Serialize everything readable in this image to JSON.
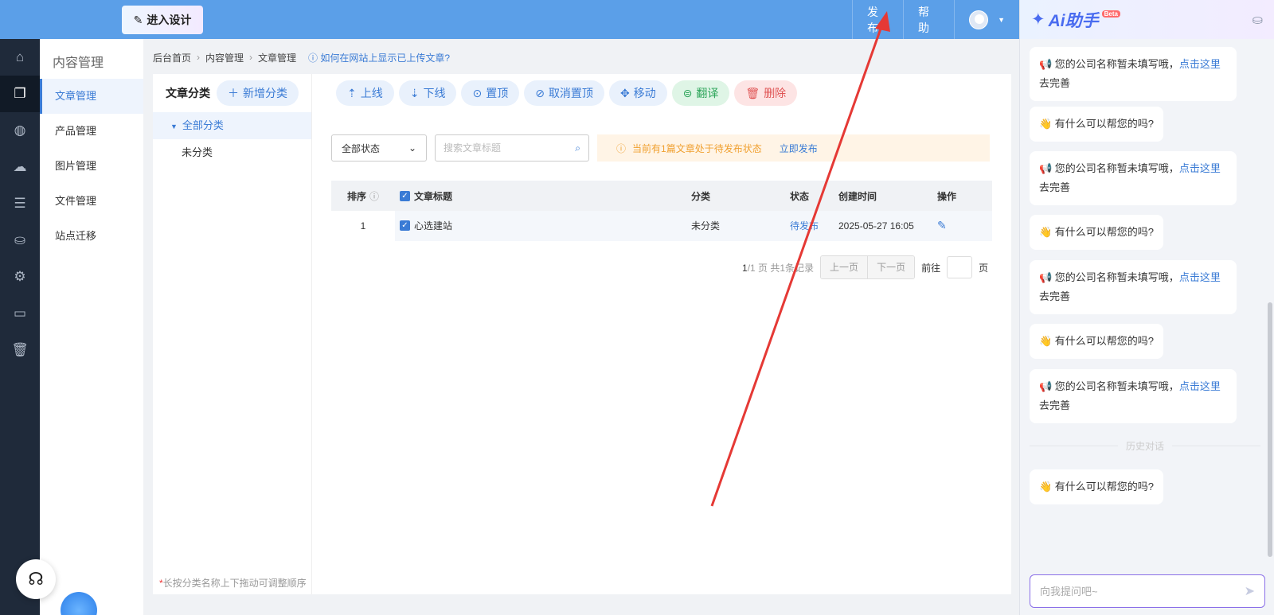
{
  "header": {
    "design_button": "进入设计",
    "publish": "发布",
    "help": "帮助"
  },
  "sidebar_icons": [
    "home-icon",
    "pages-icon",
    "planet-icon",
    "chat-icon",
    "list-icon",
    "bag-icon",
    "gear-icon",
    "terminal-icon",
    "trash-icon"
  ],
  "submenu": {
    "title": "内容管理",
    "items": [
      "文章管理",
      "产品管理",
      "图片管理",
      "文件管理",
      "站点迁移"
    ],
    "active_index": 0
  },
  "breadcrumb": {
    "items": [
      "后台首页",
      "内容管理",
      "文章管理"
    ],
    "help_link": "如何在网站上显示已上传文章?"
  },
  "categories": {
    "title": "文章分类",
    "add_button": "新增分类",
    "items": [
      "全部分类",
      "未分类"
    ],
    "tip_star": "*",
    "tip": "长按分类名称上下拖动可调整顺序"
  },
  "toolbar": {
    "online": "上线",
    "offline": "下线",
    "pin": "置顶",
    "unpin": "取消置顶",
    "move": "移动",
    "translate": "翻译",
    "delete": "删除"
  },
  "filters": {
    "status_selected": "全部状态",
    "search_placeholder": "搜索文章标题",
    "notice": "当前有1篇文章处于待发布状态",
    "notice_link": "立即发布"
  },
  "table": {
    "headers": {
      "order": "排序",
      "title": "文章标题",
      "category": "分类",
      "status": "状态",
      "created": "创建时间",
      "actions": "操作"
    },
    "rows": [
      {
        "order": "1",
        "title": "心选建站",
        "category": "未分类",
        "status": "待发布",
        "created": "2025-05-27 16:05"
      }
    ]
  },
  "pager": {
    "page_num": "1",
    "page_info": "/1 页 共1条记录",
    "prev": "上一页",
    "next": "下一页",
    "goto": "前往",
    "page_unit": "页"
  },
  "ai_panel": {
    "title": "Ai助手",
    "badge": "Beta",
    "msg_company_a": "📢 您的公司名称暂未填写哦，",
    "msg_company_link": "点击这里",
    "msg_company_b": "去完善",
    "msg_help": "👋 有什么可以帮您的吗?",
    "history_divider": "历史对话",
    "input_placeholder": "向我提问吧~"
  },
  "colors": {
    "topbar": "#5b9fe8",
    "accent": "#3a7bd5",
    "annotation_arrow": "#e53935"
  }
}
